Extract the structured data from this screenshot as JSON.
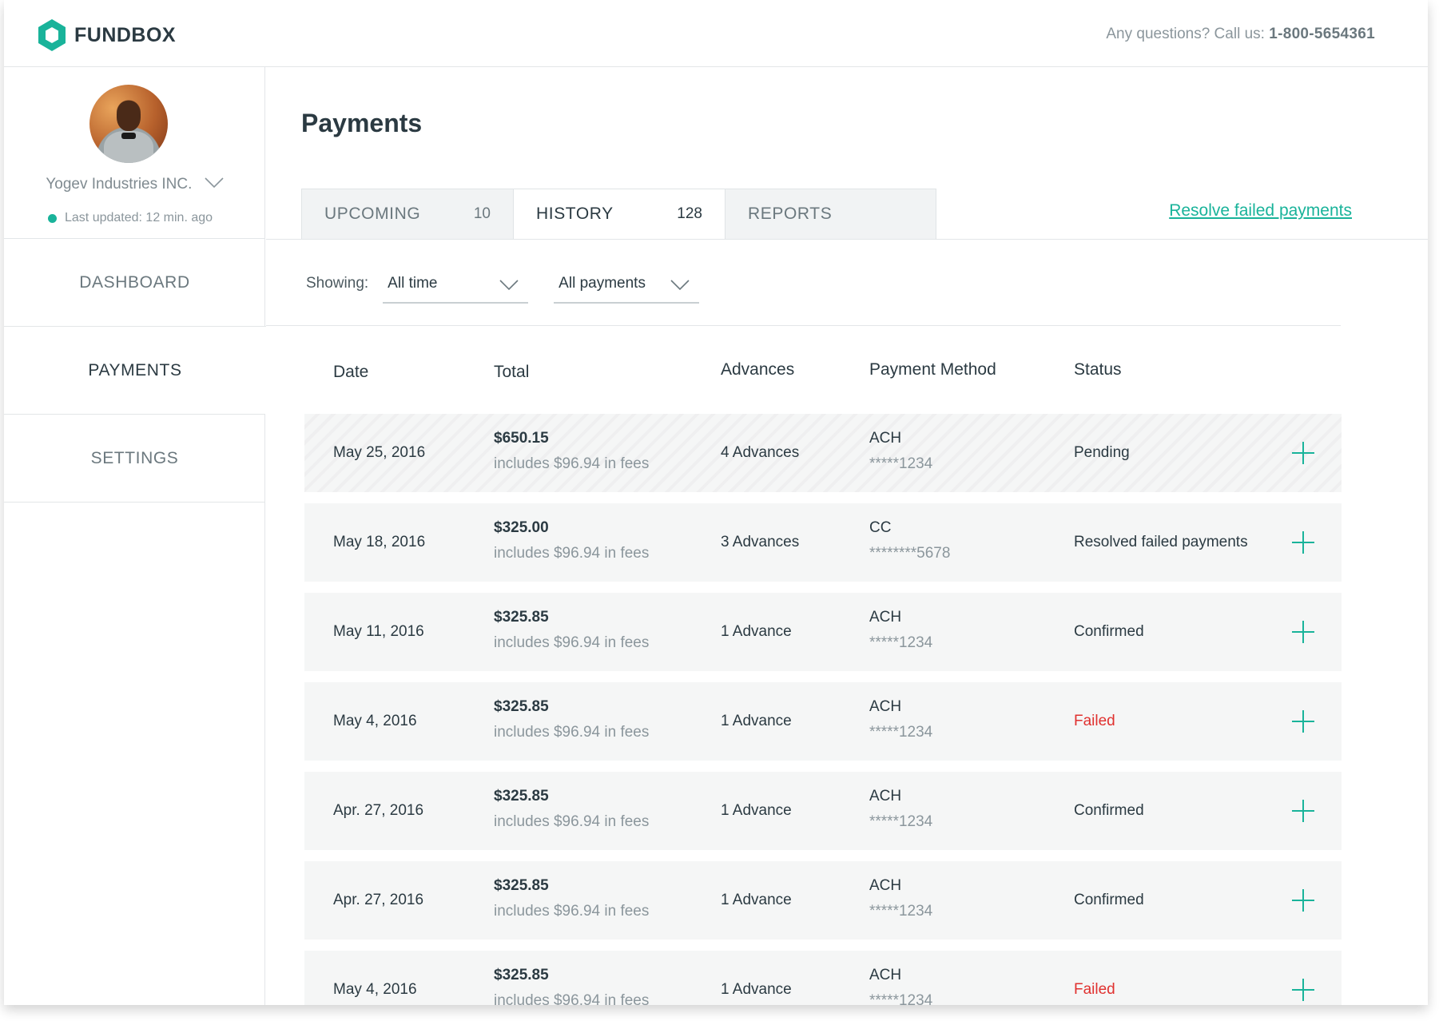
{
  "brand": {
    "name": "FUNDBOX",
    "accent": "#19b39a"
  },
  "header": {
    "contact_prefix": "Any questions? Call us:",
    "phone": "1-800-5654361"
  },
  "sidebar": {
    "company": "Yogev Industries INC.",
    "last_updated": "Last updated: 12 min. ago",
    "nav": [
      {
        "label": "DASHBOARD"
      },
      {
        "label": "PAYMENTS"
      },
      {
        "label": "SETTINGS"
      }
    ],
    "active": "PAYMENTS"
  },
  "main": {
    "title": "Payments",
    "tabs": [
      {
        "label": "UPCOMING",
        "count": "10"
      },
      {
        "label": "HISTORY",
        "count": "128"
      },
      {
        "label": "REPORTS",
        "count": ""
      }
    ],
    "active_tab": "HISTORY",
    "resolve_link": "Resolve failed payments",
    "filters": {
      "label": "Showing:",
      "time": "All time",
      "type": "All payments"
    },
    "table": {
      "columns": [
        "Date",
        "Total",
        "Advances",
        "Payment Method",
        "Status"
      ],
      "rows": [
        {
          "date": "May 25, 2016",
          "total": "$650.15",
          "fees": "includes $96.94 in fees",
          "advances": "4 Advances",
          "method": "ACH",
          "account": "*****1234",
          "status": "Pending"
        },
        {
          "date": "May 18, 2016",
          "total": "$325.00",
          "fees": "includes $96.94 in fees",
          "advances": "3 Advances",
          "method": "CC",
          "account": "********5678",
          "status": "Resolved failed payments"
        },
        {
          "date": "May 11, 2016",
          "total": "$325.85",
          "fees": "includes $96.94 in fees",
          "advances": "1 Advance",
          "method": "ACH",
          "account": "*****1234",
          "status": "Confirmed"
        },
        {
          "date": "May 4, 2016",
          "total": "$325.85",
          "fees": "includes $96.94 in fees",
          "advances": "1 Advance",
          "method": "ACH",
          "account": "*****1234",
          "status": "Failed"
        },
        {
          "date": "Apr. 27, 2016",
          "total": "$325.85",
          "fees": "includes $96.94 in fees",
          "advances": "1 Advance",
          "method": "ACH",
          "account": "*****1234",
          "status": "Confirmed"
        },
        {
          "date": "Apr. 27, 2016",
          "total": "$325.85",
          "fees": "includes $96.94 in fees",
          "advances": "1 Advance",
          "method": "ACH",
          "account": "*****1234",
          "status": "Confirmed"
        },
        {
          "date": "May 4, 2016",
          "total": "$325.85",
          "fees": "includes $96.94 in fees",
          "advances": "1 Advance",
          "method": "ACH",
          "account": "*****1234",
          "status": "Failed"
        }
      ]
    }
  },
  "colors": {
    "failed": "#e0312f",
    "accent": "#19b39a",
    "text": "#2b3a42",
    "muted": "#8b969c"
  }
}
